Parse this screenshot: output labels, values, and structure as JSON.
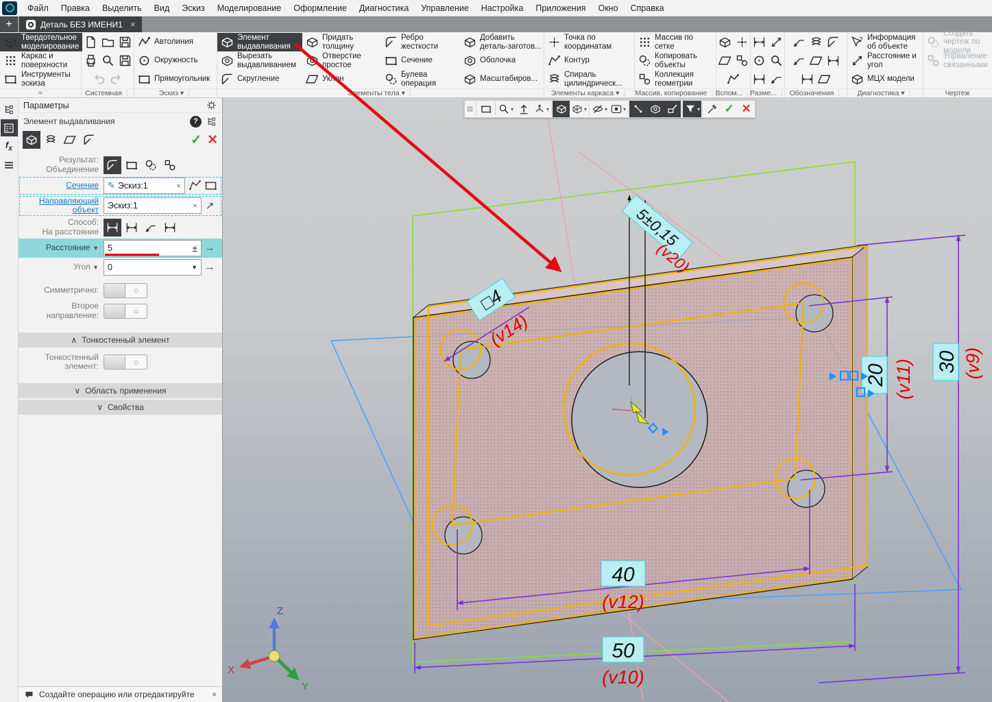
{
  "menu": {
    "items": [
      "Файл",
      "Правка",
      "Выделить",
      "Вид",
      "Эскиз",
      "Моделирование",
      "Оформление",
      "Диагностика",
      "Управление",
      "Настройка",
      "Приложения",
      "Окно",
      "Справка"
    ]
  },
  "tabs": {
    "add": "+",
    "title": "Деталь БЕЗ ИМЕНИ1",
    "close": "×"
  },
  "ribbon": {
    "modes": [
      "Твердотельное моделирование",
      "Каркас и поверхности",
      "Инструменты эскиза"
    ],
    "system": {
      "label": "Системная"
    },
    "sketch": {
      "label": "Эскиз",
      "b": [
        "Автолиния",
        "Окружность",
        "Прямоугольник"
      ]
    },
    "body": {
      "label": "Элементы тела",
      "b": [
        "Элемент выдавливания",
        "Вырезать выдавливанием",
        "Скругление",
        "Придать толщину",
        "Отверстие простое",
        "Уклон",
        "Ребро жесткости",
        "Сечение",
        "Булева операция",
        "Добавить деталь-заготов...",
        "Оболочка",
        "Масштабиров..."
      ]
    },
    "frame": {
      "label": "Элементы каркаса",
      "b": [
        "Точка по координатам",
        "Контур",
        "Спираль цилиндрическ..."
      ]
    },
    "array": {
      "label": "Массив, копирование",
      "b": [
        "Массив по сетке",
        "Копировать объекты",
        "Коллекция геометрии"
      ]
    },
    "aux": {
      "label": "Вспом..."
    },
    "razm": {
      "label": "Разме..."
    },
    "nota": {
      "label": "Обозначения"
    },
    "diag": {
      "label": "Диагностика",
      "b": [
        "Информация об объекте",
        "Расстояние и угол",
        "МЦХ модели"
      ]
    },
    "draw": {
      "label": "Чертеж",
      "b": [
        "Создать чертеж по модели",
        "Управление связанными"
      ]
    }
  },
  "params": {
    "title": "Параметры",
    "feature": "Элемент выдавливания",
    "result_label1": "Результат:",
    "result_label2": "Объединение",
    "section_link": "Сечение",
    "section_value": "Эскиз:1",
    "guide_link": "Направляющий объект",
    "guide_value": "Эскиз:1",
    "method_label1": "Способ:",
    "method_label2": "На расстояние",
    "distance_label": "Расстояние",
    "distance_value": "5",
    "angle_label": "Угол",
    "angle_value": "0",
    "symmetric_label": "Симметрично:",
    "second_dir_label": "Второе направление:",
    "thin_header": "Тонкостенный элемент",
    "thin_label": "Тонкостенный элемент:",
    "area_header": "Область применения",
    "props_header": "Свойства",
    "status": "Создайте операцию или отредактируйте"
  },
  "viewport": {
    "dims": {
      "d50": "50",
      "v10": "(v10)",
      "d40": "40",
      "v12": "(v12)",
      "d30": "30",
      "v9": "(v9)",
      "d20": "20",
      "v11": "(v11)",
      "d5": "5±0,15",
      "v20": "(v20)",
      "d4": "□4",
      "v14": "(v14)"
    },
    "axes": {
      "x": "X",
      "y": "Y",
      "z": "Z"
    }
  },
  "icons": {
    "plus": "+",
    "close": "×",
    "check": "✓",
    "cross": "✕",
    "help": "?",
    "caret": "▼",
    "caret_sm": "▾",
    "dots": "⋮",
    "arrow_right": "→",
    "plusminus": "±",
    "toggle": "○",
    "chev_up": "∧",
    "chev_down": "∨",
    "approx": "≈",
    "pencil": "✎",
    "arrow_ne": "↗"
  },
  "colors": {
    "highlight_cyan": "#b9eef2",
    "dim_purple": "#7b2fd8",
    "label_red": "#e00000",
    "sketch_yellow": "#f0b400",
    "plane_green": "#8ade2e",
    "plane_blue": "#4aa0ff",
    "arrow_red": "#e50914",
    "selected_dark": "#3d4042"
  }
}
